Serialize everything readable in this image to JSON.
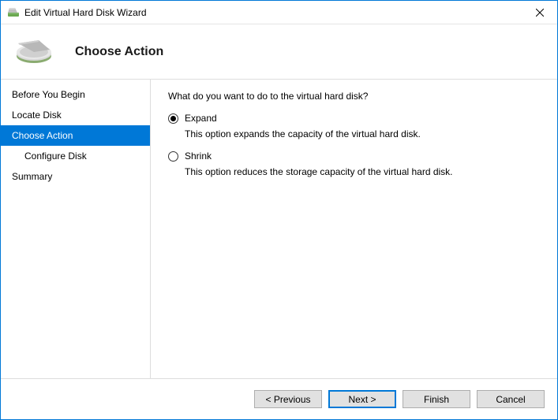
{
  "window": {
    "title": "Edit Virtual Hard Disk Wizard"
  },
  "header": {
    "heading": "Choose Action"
  },
  "sidebar": {
    "steps": {
      "before": "Before You Begin",
      "locate": "Locate Disk",
      "choose": "Choose Action",
      "configure": "Configure Disk",
      "summary": "Summary"
    }
  },
  "main": {
    "prompt": "What do you want to do to the virtual hard disk?",
    "options": {
      "expand": {
        "label": "Expand",
        "desc": "This option expands the capacity of the virtual hard disk.",
        "selected": true
      },
      "shrink": {
        "label": "Shrink",
        "desc": "This option reduces the storage capacity of the virtual hard disk.",
        "selected": false
      }
    }
  },
  "footer": {
    "previous": "< Previous",
    "next": "Next >",
    "finish": "Finish",
    "cancel": "Cancel"
  }
}
